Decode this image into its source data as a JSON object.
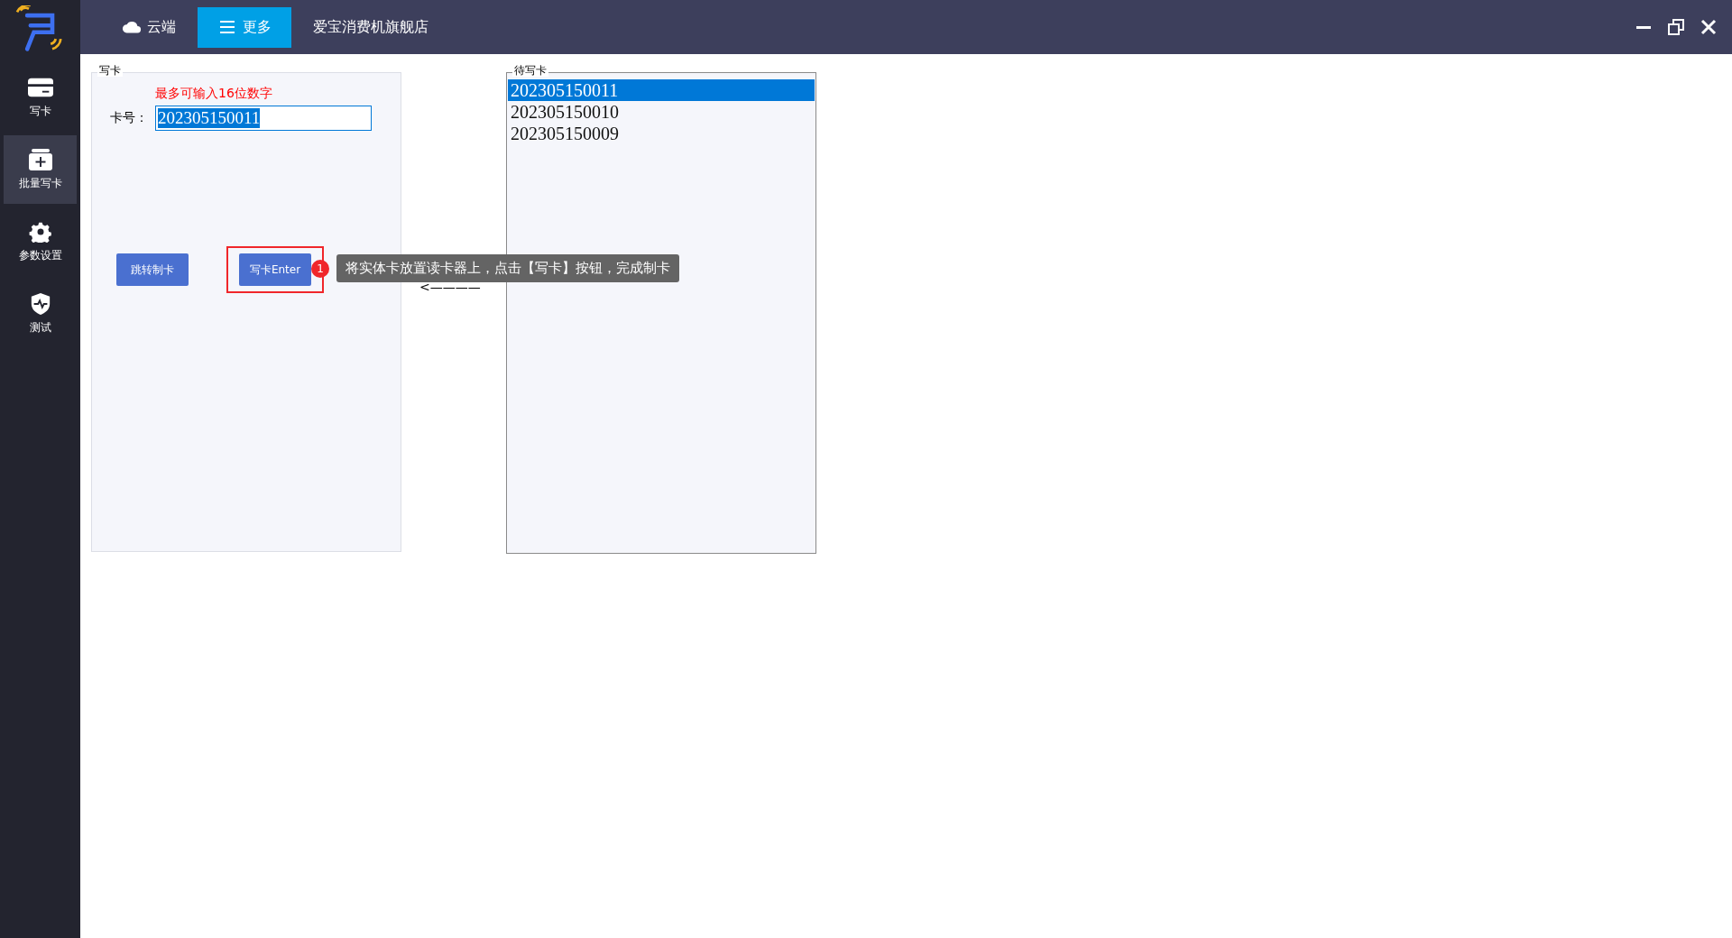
{
  "top_bar": {
    "tabs": [
      {
        "label": "云端",
        "kind": "cloud",
        "selected": false
      },
      {
        "label": "更多",
        "kind": "menu",
        "selected": true
      },
      {
        "label": "爱宝消费机旗舰店",
        "kind": "plain",
        "selected": false
      }
    ]
  },
  "sidebar": {
    "items": [
      {
        "label": "写卡",
        "kind": "card",
        "selected": false
      },
      {
        "label": "批量写卡",
        "kind": "batch",
        "selected": true
      },
      {
        "label": "参数设置",
        "kind": "gear",
        "selected": false
      },
      {
        "label": "测试",
        "kind": "shield",
        "selected": false
      }
    ]
  },
  "write_panel": {
    "title": "写卡",
    "hint": "最多可输入16位数字",
    "card_label": "卡号：",
    "card_value": "202305150011",
    "buttons": [
      {
        "label": "跳转制卡",
        "highlighted": false
      },
      {
        "label": "写卡Enter",
        "highlighted": true
      }
    ],
    "tip": {
      "badge": "1",
      "text": "将实体卡放置读卡器上，点击【写卡】按钮，完成制卡"
    },
    "arrow": "<————"
  },
  "pending_panel": {
    "title": "待写卡",
    "items": [
      {
        "label": "202305150011",
        "selected": true
      },
      {
        "label": "202305150010",
        "selected": false
      },
      {
        "label": "202305150009",
        "selected": false
      }
    ]
  }
}
